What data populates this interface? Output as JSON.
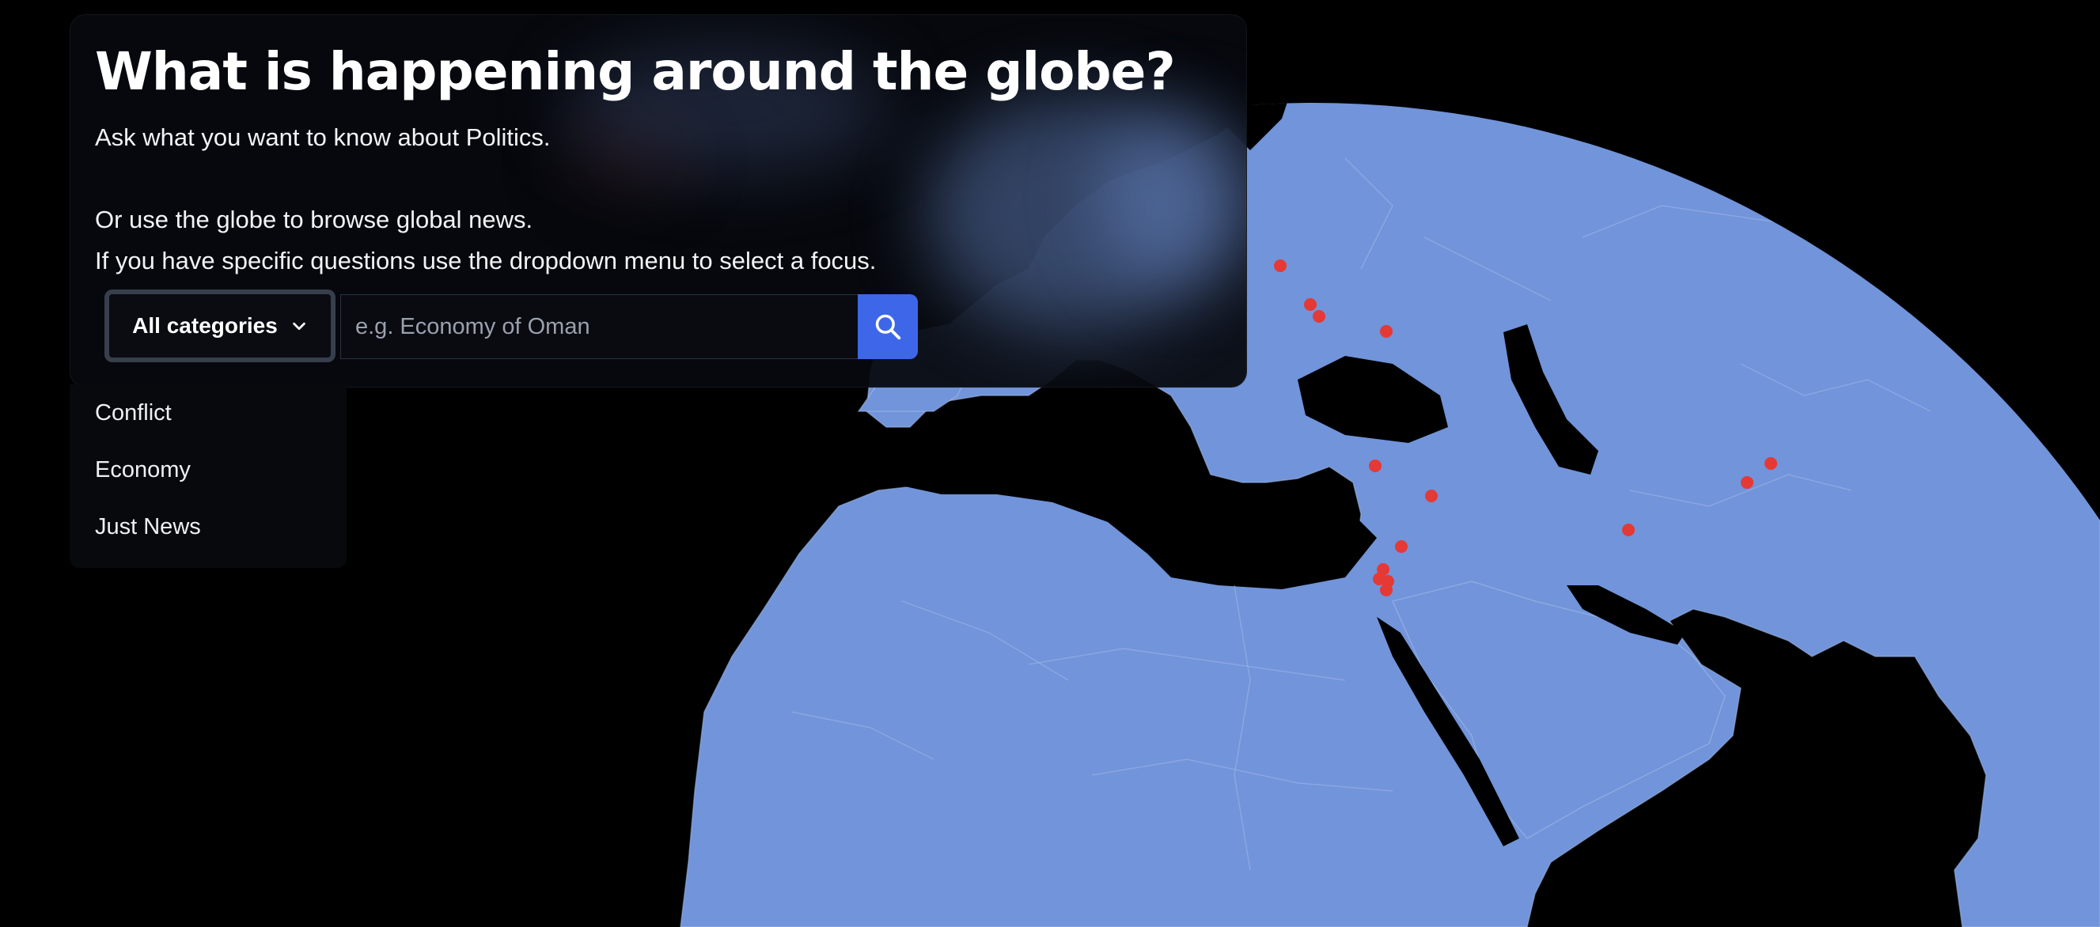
{
  "header": {
    "title": "What is happening around the globe?",
    "subtitle": "Ask what you want to know about Politics.",
    "browse_hint": "Or use the globe to browse global news.",
    "dropdown_hint": "If you have specific questions use the dropdown menu to select a focus."
  },
  "search": {
    "category_label": "All categories",
    "placeholder": "e.g. Economy of Oman",
    "value": ""
  },
  "dropdown": {
    "options": [
      "Conflict",
      "Economy",
      "Just News"
    ]
  },
  "globe": {
    "land_color": "#7194da",
    "ocean_color": "#000000",
    "marker_color": "#e53935",
    "marker_count": 18
  },
  "colors": {
    "accent": "#3d67e8",
    "panel_bg": "#06080e"
  }
}
